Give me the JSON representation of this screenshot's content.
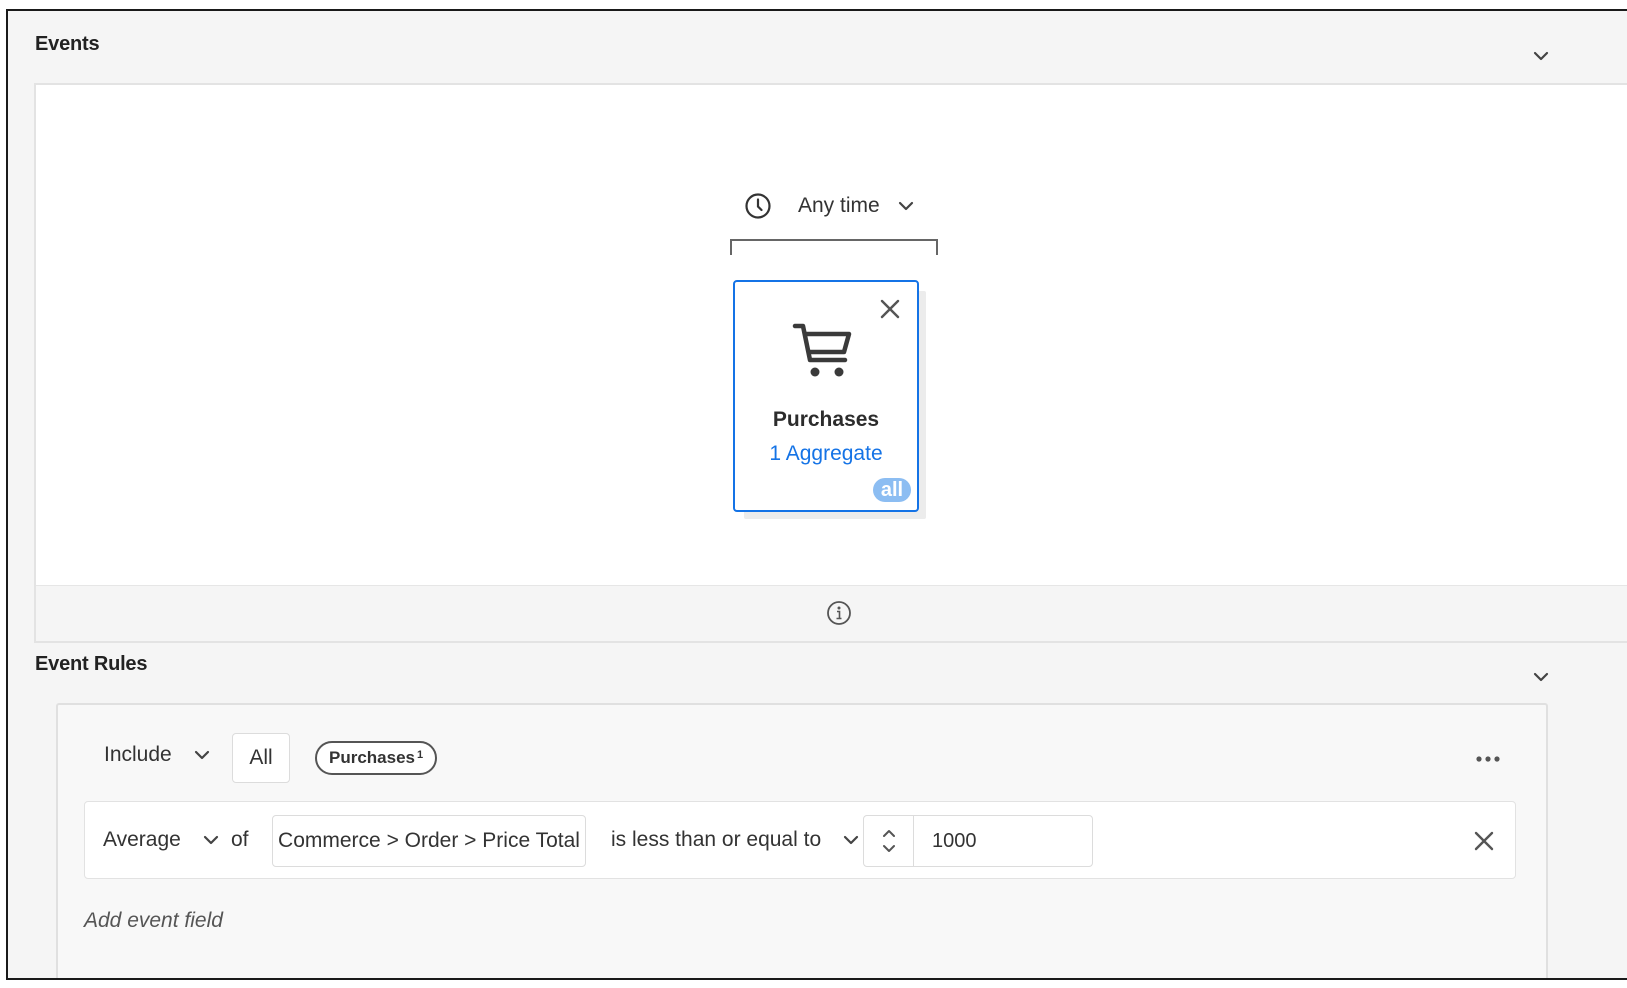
{
  "events_section": {
    "title": "Events",
    "time_picker": {
      "label": "Any time"
    },
    "event_card": {
      "title": "Purchases",
      "link": "1 Aggregate",
      "badge": "all"
    }
  },
  "event_rules_section": {
    "title": "Event Rules",
    "include_dropdown": "Include",
    "all_button": "All",
    "event_pill": {
      "label": "Purchases",
      "superscript": "1"
    },
    "rule": {
      "aggregate_dropdown": "Average",
      "of_text": "of",
      "field": "Commerce > Order > Price Total",
      "operator_dropdown": "is less than or equal to",
      "value": "1000"
    },
    "add_field_label": "Add event field"
  },
  "icons": [
    "chevron-down-icon",
    "clock-icon",
    "close-icon",
    "shopping-cart-icon",
    "info-icon",
    "more-icon",
    "stepper-icon"
  ],
  "colors": {
    "accent": "#1473e6",
    "badge": "#8cbdf2",
    "background": "#f5f5f5"
  }
}
